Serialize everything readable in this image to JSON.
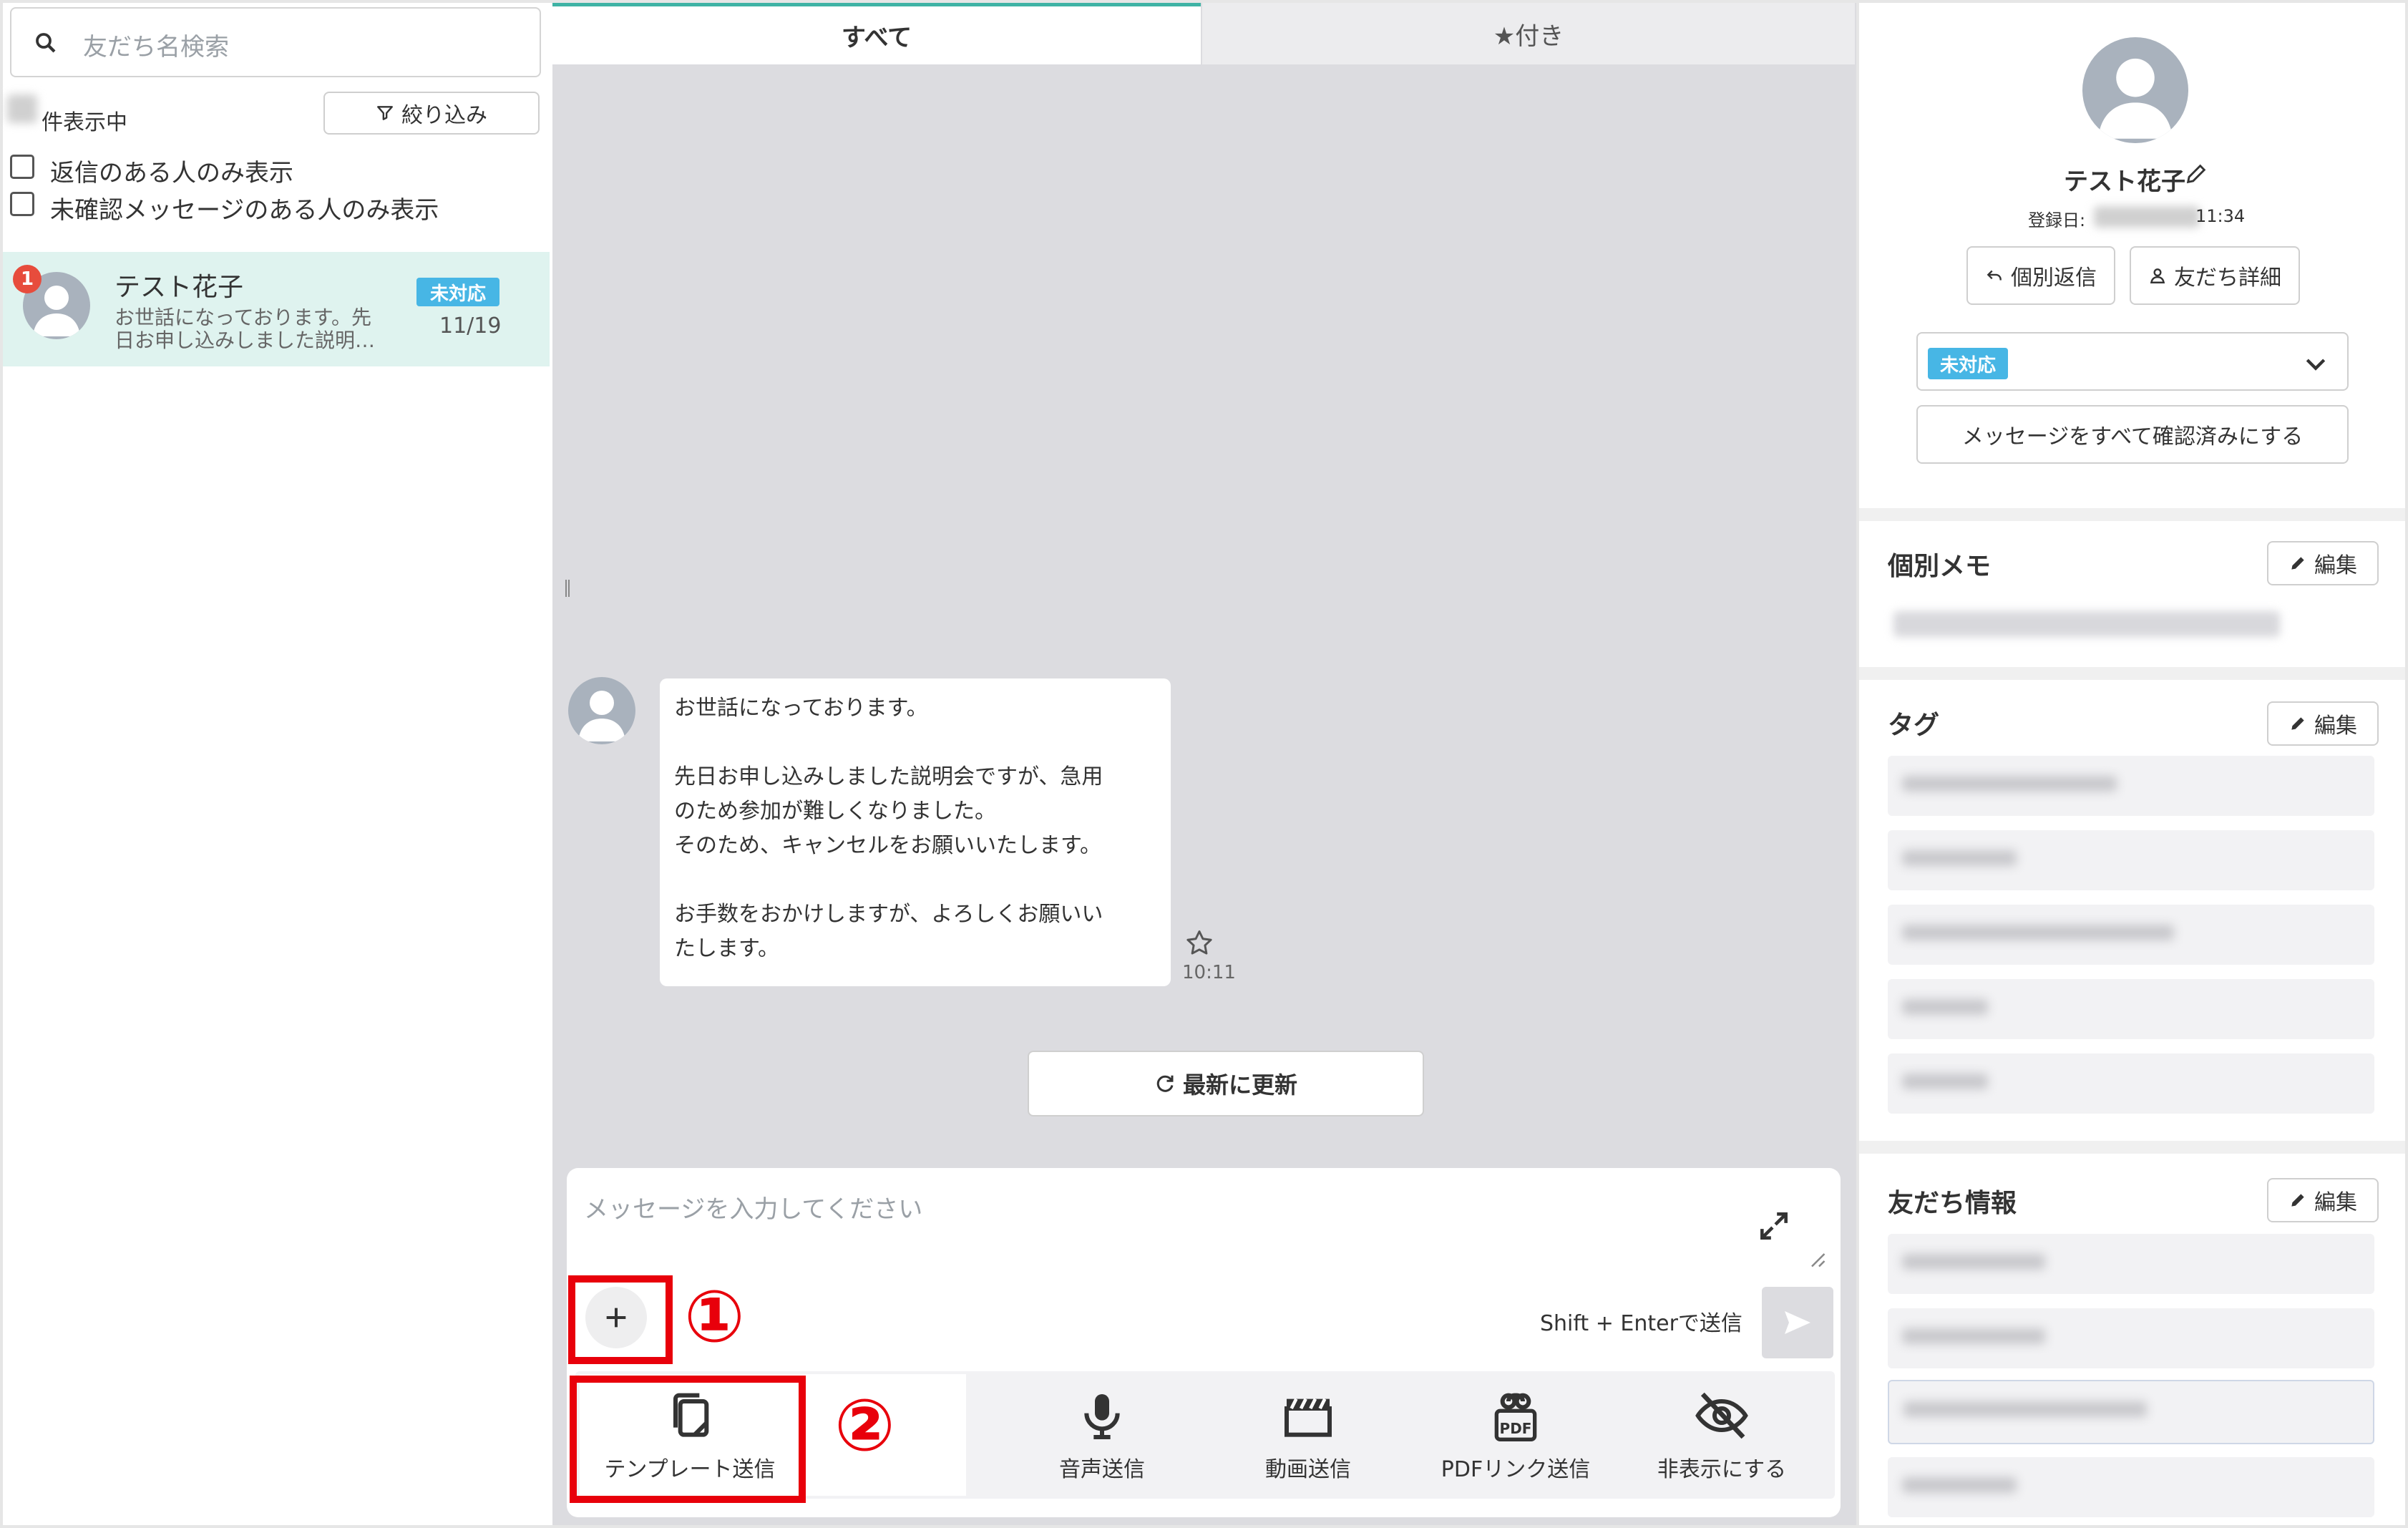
{
  "left": {
    "search_placeholder": "友だち名検索",
    "count_label": "件表示中",
    "filter_button": "絞り込み",
    "checkbox_replied": "返信のある人のみ表示",
    "checkbox_unread": "未確認メッセージのある人のみ表示",
    "friend": {
      "name": "テスト花子",
      "preview_line1": "お世話になっております。先",
      "preview_line2": "日お申し込みしました説明…",
      "status": "未対応",
      "date": "11/19",
      "unread_count": "1"
    }
  },
  "center": {
    "tab_all": "すべて",
    "tab_starred": "★付き",
    "message_lines": [
      "お世話になっております。",
      "",
      "先日お申し込みしました説明会ですが、急用",
      "のため参加が難しくなりました。",
      "そのため、キャンセルをお願いいたします。",
      "",
      "お手数をおかけしますが、よろしくお願いい",
      "たします。"
    ],
    "message_time": "10:11",
    "refresh_button": "最新に更新",
    "input_placeholder": "メッセージを入力してください",
    "send_hint": "Shift + Enterで送信",
    "annotation_1": "①",
    "annotation_2": "②",
    "tools": [
      {
        "label": "テンプレート送信",
        "icon": "template-icon"
      },
      {
        "label": "音声送信",
        "icon": "microphone-icon"
      },
      {
        "label": "動画送信",
        "icon": "video-icon"
      },
      {
        "label": "PDFリンク送信",
        "icon": "pdf-link-icon"
      },
      {
        "label": "非表示にする",
        "icon": "eye-off-icon"
      }
    ]
  },
  "right": {
    "name": "テスト花子",
    "registered_label": "登録日:",
    "registered_time": "11:34",
    "reply_button": "個別返信",
    "detail_button": "友だち詳細",
    "status": "未対応",
    "mark_all_read": "メッセージをすべて確認済みにする",
    "memo_title": "個別メモ",
    "tag_title": "タグ",
    "info_title": "友だち情報",
    "edit_label": "編集"
  },
  "colors": {
    "accent_teal": "#3fb3a5",
    "status_blue": "#47b6e5",
    "annotation_red": "#e8000b",
    "badge_red": "#e74c3c"
  }
}
